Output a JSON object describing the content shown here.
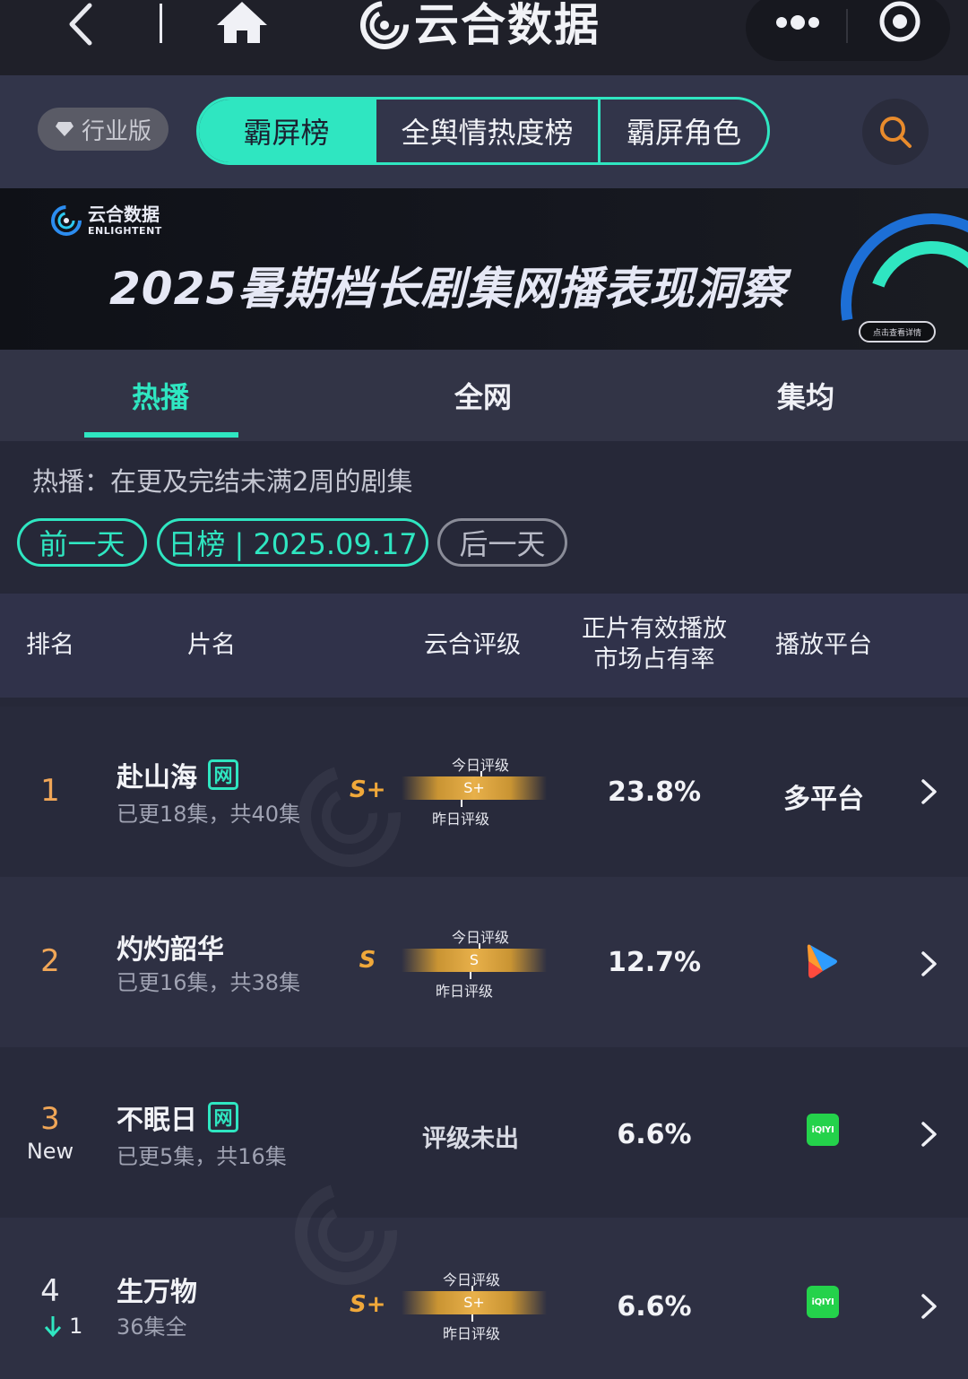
{
  "brand": {
    "name": "云合数据"
  },
  "header": {
    "industry_label": "行业版",
    "tabs": [
      "霸屏榜",
      "全舆情热度榜",
      "霸屏角色"
    ],
    "active_tab": 0
  },
  "banner": {
    "logo_name": "云合数据",
    "logo_en": "ENLIGHTENT",
    "title": "2025暑期档长剧集网播表现洞察",
    "button": "点击查看详情"
  },
  "subtabs": [
    "热播",
    "全网",
    "集均"
  ],
  "filter": {
    "description": "热播：在更及完结未满2周的剧集",
    "prev": "前一天",
    "current": "日榜 | 2025.09.17",
    "next": "后一天"
  },
  "table": {
    "headers": {
      "rank": "排名",
      "title": "片名",
      "grade": "云合评级",
      "share_l1": "正片有效播放",
      "share_l2": "市场占有率",
      "platform": "播放平台"
    },
    "grade_today_label": "今日评级",
    "grade_yesterday_label": "昨日评级",
    "rows": [
      {
        "rank": "1",
        "rank_sub": "",
        "title": "赴山海",
        "wang": "网",
        "episodes": "已更18集，共40集",
        "grade_today": "S+",
        "grade_bar": "S+",
        "grade_text": "",
        "share": "23.8%",
        "platform": "多平台",
        "platform_icon": ""
      },
      {
        "rank": "2",
        "rank_sub": "",
        "title": "灼灼韶华",
        "wang": "",
        "episodes": "已更16集，共38集",
        "grade_today": "S",
        "grade_bar": "S",
        "grade_text": "",
        "share": "12.7%",
        "platform": "",
        "platform_icon": "youku-icon"
      },
      {
        "rank": "3",
        "rank_sub": "New",
        "title": "不眠日",
        "wang": "网",
        "episodes": "已更5集，共16集",
        "grade_today": "",
        "grade_bar": "",
        "grade_text": "评级未出",
        "share": "6.6%",
        "platform": "",
        "platform_icon": "iqiyi-icon"
      },
      {
        "rank": "4",
        "rank_sub": "1",
        "title": "生万物",
        "wang": "",
        "episodes": "36集全",
        "grade_today": "S+",
        "grade_bar": "S+",
        "grade_text": "",
        "share": "6.6%",
        "platform": "",
        "platform_icon": "iqiyi-icon"
      }
    ],
    "iqiyi_text": "iQIYI"
  },
  "colors": {
    "accent": "#2fe6c1",
    "rank": "#f0a657",
    "grade": "#f0a83a",
    "background": "#262838"
  }
}
